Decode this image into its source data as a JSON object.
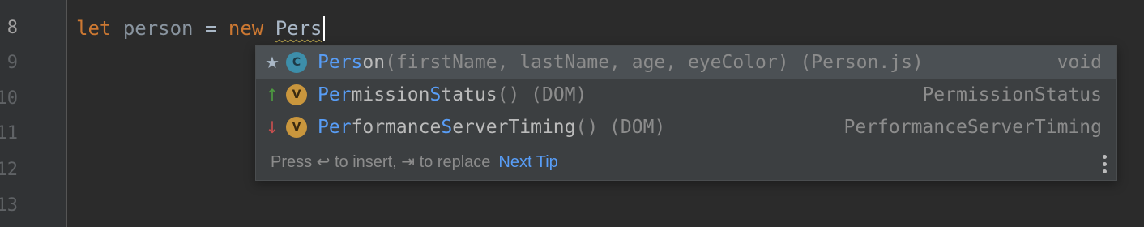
{
  "gutter": {
    "lines": [
      "8",
      "9",
      "10",
      "11",
      "12",
      "13"
    ],
    "current_line": "8"
  },
  "code": {
    "kw_let": "let",
    "ident": "person",
    "op": "=",
    "kw_new": "new",
    "typed": "Pers"
  },
  "completion": {
    "items": [
      {
        "marker": "★",
        "kind": "C",
        "match1": "Pers",
        "rest1": "on",
        "match2": "",
        "rest2": "",
        "tail": "(firstName, lastName, age, eyeColor) (Person.js)",
        "type": "void"
      },
      {
        "marker": "↑",
        "kind": "V",
        "match1": "Per",
        "rest1": "mission",
        "match2": "S",
        "rest2": "tatus",
        "tail": "() (DOM)",
        "type": "PermissionStatus"
      },
      {
        "marker": "↓",
        "kind": "V",
        "match1": "Per",
        "rest1": "formance",
        "match2": "S",
        "rest2": "erverTiming",
        "tail": "() (DOM)",
        "type": "PerformanceServerTiming"
      }
    ],
    "footer": {
      "text": "Press ↩ to insert, ⇥ to replace",
      "next_tip": "Next Tip"
    }
  },
  "colors": {
    "background": "#2b2b2b",
    "keyword": "#cc7832",
    "match": "#589df6",
    "popup": "#3c3f41",
    "selected_row": "#4b5054"
  }
}
